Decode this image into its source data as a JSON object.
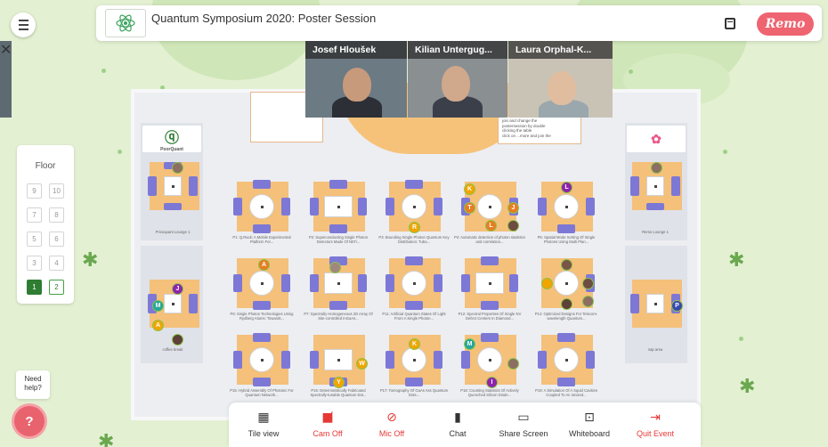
{
  "header": {
    "title": "Quantum Symposium 2020: Poster Session",
    "brand": "Remo",
    "icons": [
      "menu-icon",
      "event-logo",
      "calendar-icon"
    ]
  },
  "colors": {
    "background": "#e3f0d2",
    "brand": "#ee6470",
    "active_floor": "#2e7d32",
    "table_rug": "#f4c07a",
    "cushion": "#7d78d6",
    "danger": "#e53935"
  },
  "floor_panel": {
    "label": "Floor",
    "floors": [
      "9",
      "10",
      "7",
      "8",
      "5",
      "6",
      "3",
      "4",
      "1",
      "2"
    ],
    "active_floor": "1"
  },
  "videos": [
    {
      "name": "Josef Hloušek",
      "muted": false
    },
    {
      "name": "Kilian Untergug...",
      "muted": true
    },
    {
      "name": "Laura Orphal-K...",
      "muted": false
    }
  ],
  "stage_note": {
    "lines": [
      "join and change the",
      "postersession by double",
      "clicking the table",
      "click on ...more and join the"
    ]
  },
  "lounges": {
    "left_logo": "PoorQuant",
    "left_top_caption": "Pricequant Lounge 1",
    "left_bottom_caption": "coffee break",
    "right_top_caption": "Remo Lounge 1",
    "right_bottom_caption": "nap area"
  },
  "tables": {
    "row1": [
      "P1: Q.Rack: A Mobile Experimental Platform For...",
      "P2: Superconducting Single Photon Detectors Made Of NbTi...",
      "P3: Bounding Single Photon Quantum Key Distribution: Tuba...",
      "P4: Automatic detection of photon statistics and correlation...",
      "P5: Spatial Mode Sorting Of Single Photons Using Multi Plan..."
    ],
    "row2": [
      "P6: Single Photon Technologies Using Rydberg Atoms: Towards...",
      "P7: Spectrally Homogeneous 2D Array Of Site-controlled InGaAs...",
      "P11: Artificial Quantum States Of Light From A Single Photon...",
      "P12: Spectral Properties Of Single NV Defect Centers In Diamond...",
      "P14: Optimized Designs For Telecom-wavelength Quantum..."
    ],
    "row3": [
      "P15: Hybrid Assembly Of Photonic For Quantum Network...",
      "P16: Deterministically Fabricated Spectrally-tunable Quantum Dot...",
      "P17: Tomography Of GaAs Ass Quantum Dots...",
      "P18: Counting Statistics Of Actively Quenched Silicon Diode...",
      "P19: A Simulation Of A Squid Cavities Coupled To An Ionized..."
    ]
  },
  "avatars": [
    "R",
    "K",
    "T",
    "J",
    "L",
    "L",
    "A",
    "J",
    "M",
    "A",
    "K",
    "W",
    "Y",
    "M",
    "I",
    "P"
  ],
  "toolbar": {
    "tile_view": "Tile view",
    "cam_off": "Cam Off",
    "mic_off": "Mic Off",
    "chat": "Chat",
    "share_screen": "Share Screen",
    "whiteboard": "Whiteboard",
    "quit_event": "Quit Event"
  },
  "help": {
    "label": "Need help?",
    "button": "?"
  }
}
